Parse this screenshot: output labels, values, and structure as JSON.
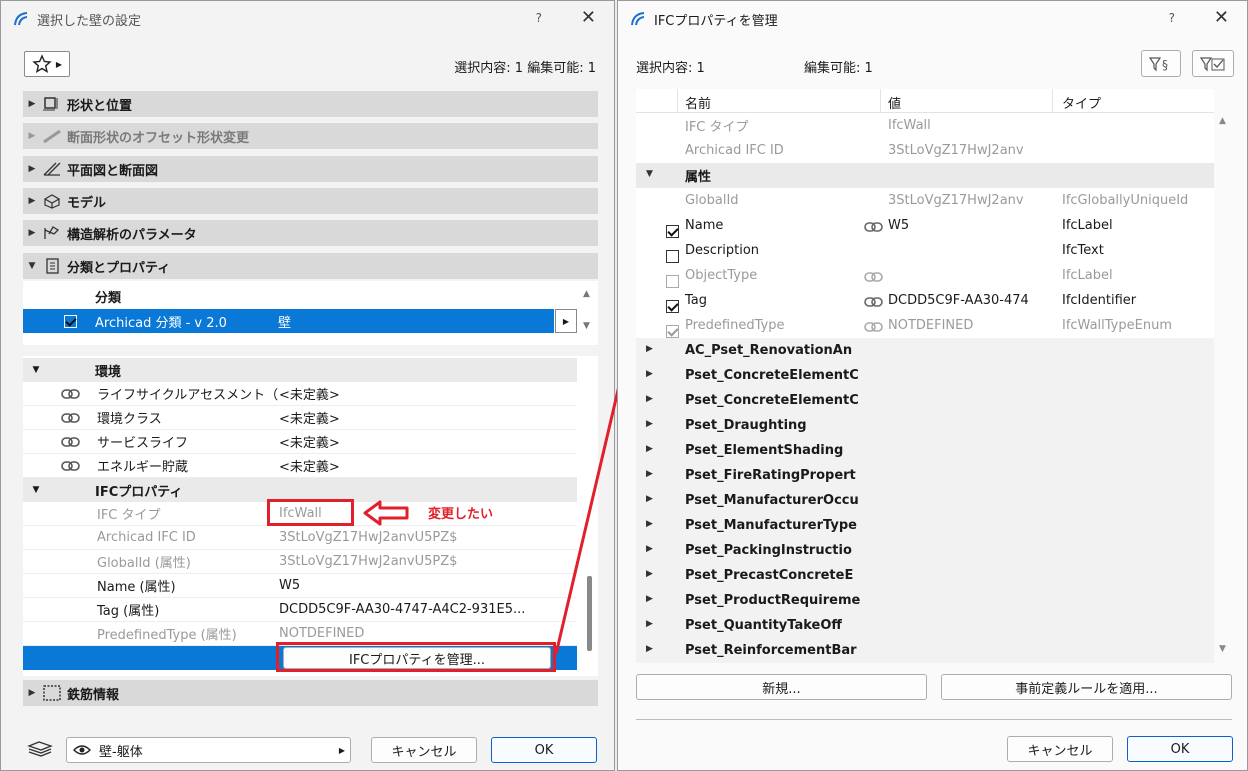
{
  "left_dialog": {
    "title": "選択した壁の設定",
    "help": "?",
    "close": "✕",
    "selection_info": "選択内容: 1 編集可能: 1",
    "sections": {
      "shape": "形状と位置",
      "profile": "断面形状のオフセット形状変更",
      "plan": "平面図と断面図",
      "model": "モデル",
      "structural": "構造解析のパラメータ",
      "classification": "分類とプロパティ",
      "rebar": "鉄筋情報"
    },
    "classification_header": "分類",
    "classification_row": {
      "system": "Archicad 分類 - v 2.0",
      "value": "壁"
    },
    "environment_header": "環境",
    "environment_rows": [
      {
        "name": "ライフサイクルアセスメント（LC...",
        "value": "<未定義>"
      },
      {
        "name": "環境クラス",
        "value": "<未定義>"
      },
      {
        "name": "サービスライフ",
        "value": "<未定義>"
      },
      {
        "name": "エネルギー貯蔵",
        "value": "<未定義>"
      }
    ],
    "ifc_header": "IFCプロパティ",
    "ifc_rows": [
      {
        "name": "IFC タイプ",
        "value": "IfcWall"
      },
      {
        "name": "Archicad IFC ID",
        "value": "3StLoVgZ17HwJ2anvU5PZ$"
      },
      {
        "name": "GlobalId (属性)",
        "value": "3StLoVgZ17HwJ2anvU5PZ$"
      },
      {
        "name": "Name (属性)",
        "value": "W5"
      },
      {
        "name": "Tag (属性)",
        "value": "DCDD5C9F-AA30-4747-A4C2-931E5..."
      },
      {
        "name": "PredefinedType (属性)",
        "value": "NOTDEFINED"
      }
    ],
    "manage_button": "IFCプロパティを管理...",
    "annotation": "変更したい",
    "layer": "壁-躯体",
    "cancel": "キャンセル",
    "ok": "OK"
  },
  "right_dialog": {
    "title": "IFCプロパティを管理",
    "help": "?",
    "close": "✕",
    "selection": "選択内容: 1",
    "editable": "編集可能: 1",
    "columns": {
      "name": "名前",
      "value": "値",
      "type": "タイプ"
    },
    "top_rows": [
      {
        "name": "IFC タイプ",
        "value": "IfcWall"
      },
      {
        "name": "Archicad IFC ID",
        "value": "3StLoVgZ17HwJ2anv"
      }
    ],
    "attributes_header": "属性",
    "attribute_rows": [
      {
        "name": "GlobalId",
        "value": "3StLoVgZ17HwJ2anv",
        "type": "IfcGloballyUniqueId"
      },
      {
        "name": "Name",
        "value": "W5",
        "type": "IfcLabel"
      },
      {
        "name": "Description",
        "value": "",
        "type": "IfcText"
      },
      {
        "name": "ObjectType",
        "value": "",
        "type": "IfcLabel"
      },
      {
        "name": "Tag",
        "value": "DCDD5C9F-AA30-474",
        "type": "IfcIdentifier"
      },
      {
        "name": "PredefinedType",
        "value": "NOTDEFINED",
        "type": "IfcWallTypeEnum"
      }
    ],
    "psets": [
      "AC_Pset_RenovationAn",
      "Pset_ConcreteElementC",
      "Pset_ConcreteElementC",
      "Pset_Draughting",
      "Pset_ElementShading",
      "Pset_FireRatingPropert",
      "Pset_ManufacturerOccu",
      "Pset_ManufacturerType",
      "Pset_PackingInstructio",
      "Pset_PrecastConcreteE",
      "Pset_ProductRequireme",
      "Pset_QuantityTakeOff",
      "Pset_ReinforcementBar"
    ],
    "new_button": "新規...",
    "apply_rules_button": "事前定義ルールを適用...",
    "cancel": "キャンセル",
    "ok": "OK"
  },
  "colors": {
    "selection_blue": "#0a78d7",
    "annotation_red": "#e0202a"
  }
}
